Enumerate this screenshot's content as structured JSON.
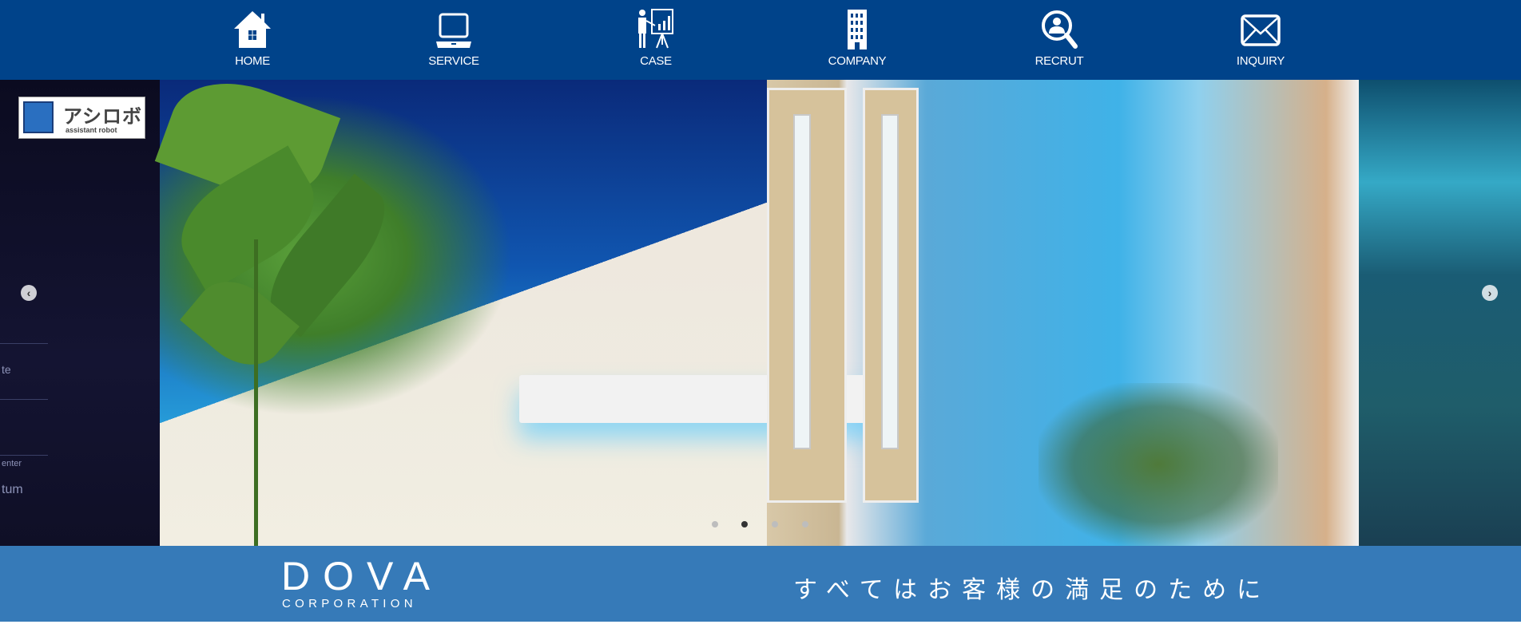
{
  "nav": {
    "items": [
      {
        "label": "HOME",
        "icon": "home-icon"
      },
      {
        "label": "SERVICE",
        "icon": "laptop-icon"
      },
      {
        "label": "CASE",
        "icon": "presentation-icon"
      },
      {
        "label": "COMPANY",
        "icon": "building-icon"
      },
      {
        "label": "RECRUT",
        "icon": "person-search-icon"
      },
      {
        "label": "INQUIRY",
        "icon": "envelope-icon"
      }
    ]
  },
  "slider": {
    "badge": {
      "kana": "アシロボ",
      "sub": "assistant robot"
    },
    "left_panel_text": [
      "te",
      "enter",
      "tum"
    ],
    "prev": "‹",
    "next": "›",
    "dots": 4,
    "active_dot": 2
  },
  "band": {
    "logo": "DOVA",
    "logo_sub": "CORPORATION",
    "tagline": "すべてはお客様の満足のために"
  },
  "colors": {
    "nav": "#00438a",
    "band": "#367ab8"
  }
}
